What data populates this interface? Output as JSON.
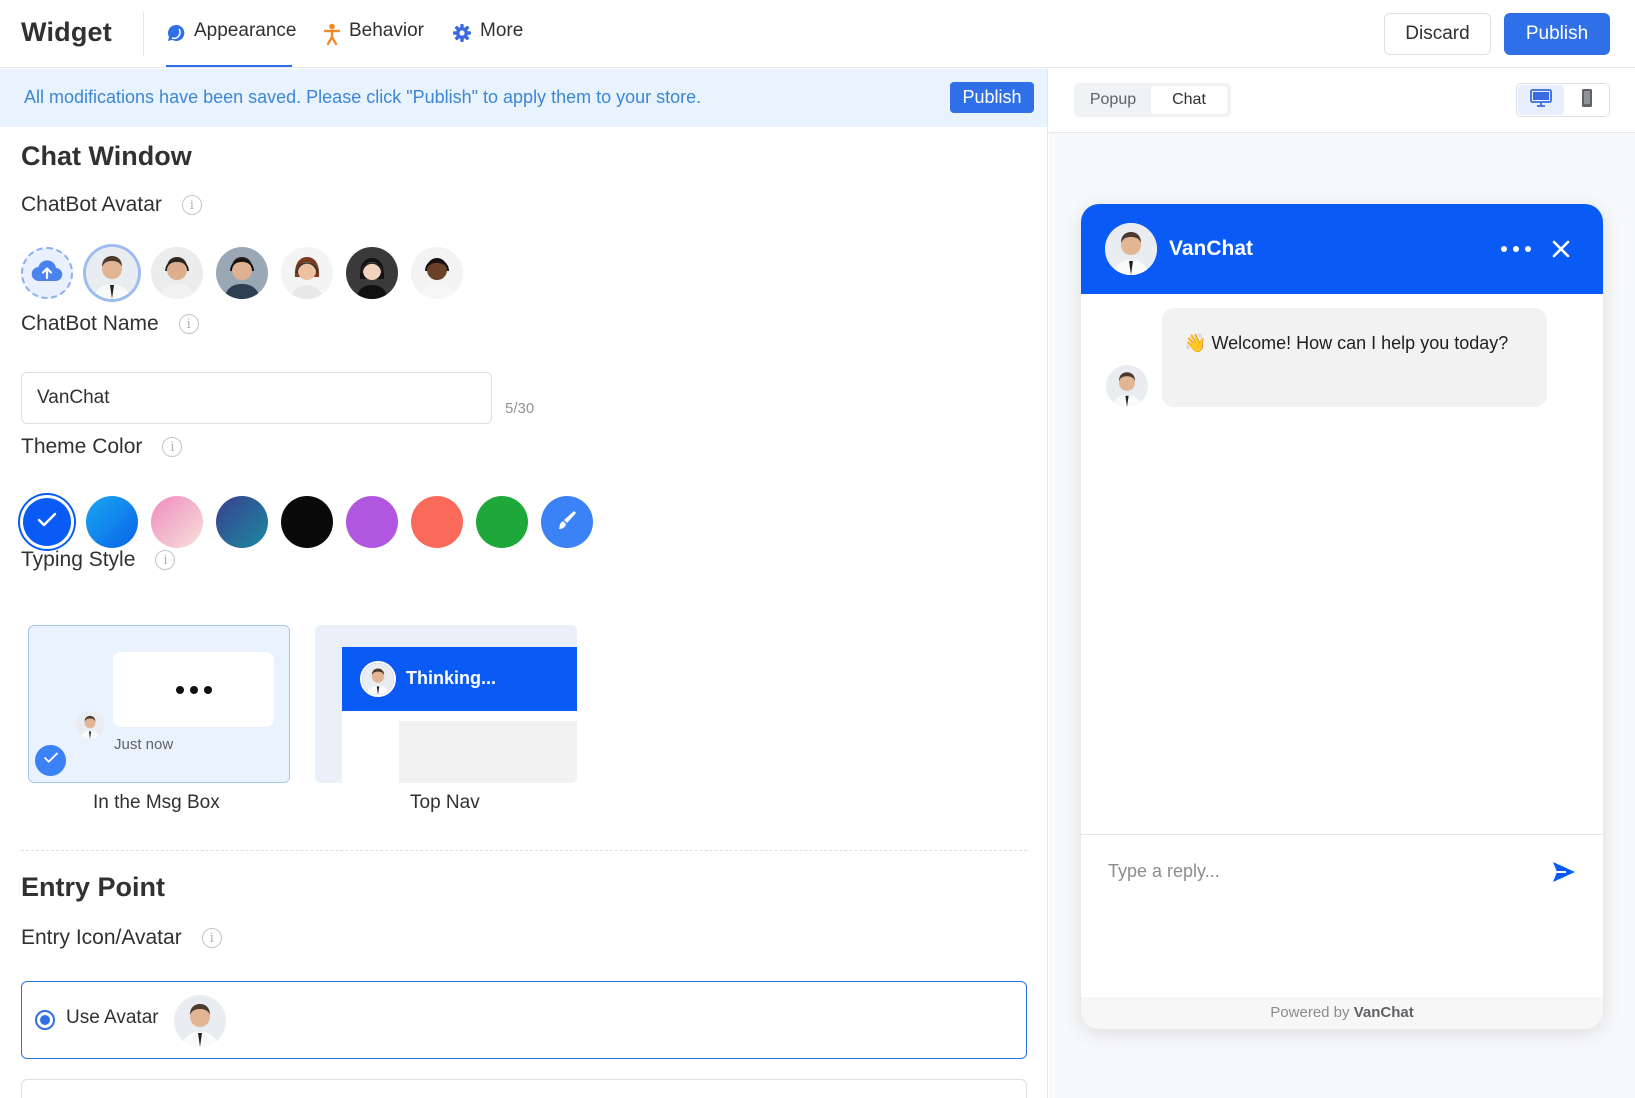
{
  "header": {
    "brand": "Widget",
    "tabs": [
      {
        "label": "Appearance",
        "icon": "chat-bubble-icon"
      },
      {
        "label": "Behavior",
        "icon": "person-icon"
      },
      {
        "label": "More",
        "icon": "gear-icon"
      }
    ],
    "discard_label": "Discard",
    "publish_label": "Publish"
  },
  "banner": {
    "text": "All modifications have been saved. Please click \"Publish\" to apply them to your store.",
    "button": "Publish"
  },
  "chat_window": {
    "heading": "Chat Window",
    "avatar_label": "ChatBot Avatar",
    "name_label": "ChatBot Name",
    "name_value": "VanChat",
    "name_counter": "5/30",
    "theme_label": "Theme Color",
    "theme_colors": [
      "#0a5bf5",
      "#0b84f0",
      "#f0a6c8",
      "#2a5a9a",
      "#0a0a0a",
      "#b156de",
      "#fa6a5a",
      "#1fa83a",
      "#3a82f5"
    ],
    "typing_label": "Typing Style",
    "typing_options": [
      {
        "caption": "In the Msg Box",
        "time": "Just now",
        "selected": true
      },
      {
        "caption": "Top Nav",
        "header_text": "Thinking...",
        "selected": false
      }
    ]
  },
  "entry_point": {
    "heading": "Entry Point",
    "icon_label": "Entry Icon/Avatar",
    "option_avatar": "Use Avatar"
  },
  "preview": {
    "tabs": [
      "Popup",
      "Chat"
    ],
    "active_tab": "Chat",
    "bot_name": "VanChat",
    "welcome_emoji": "👋",
    "welcome": "Welcome! How can I help you today?",
    "reply_placeholder": "Type a reply...",
    "powered_prefix": "Powered by ",
    "powered_brand": "VanChat",
    "accent": "#0a5bf5"
  }
}
